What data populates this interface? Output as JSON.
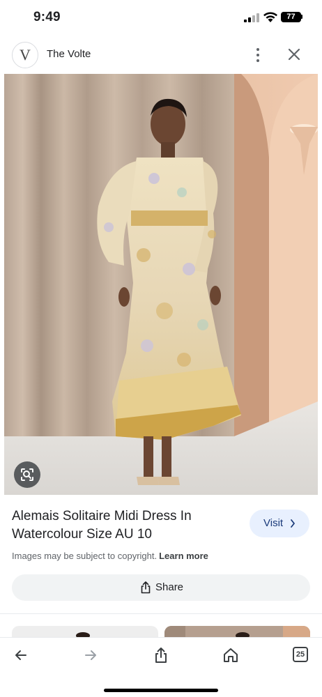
{
  "status_bar": {
    "time": "9:49",
    "battery": "77"
  },
  "header": {
    "logo_letter": "V",
    "site_name": "The Volte"
  },
  "result": {
    "title": "Alemais Solitaire Midi Dress In Watercolour Size AU 10",
    "visit_label": "Visit",
    "copyright_text": "Images may be subject to copyright.",
    "learn_more_label": "Learn more",
    "share_label": "Share"
  },
  "bottom_nav": {
    "tab_count": "25"
  },
  "icons": {
    "back": "arrow-left-icon",
    "forward": "arrow-right-icon",
    "share": "share-icon",
    "home": "home-icon",
    "more": "more-vert-icon",
    "close": "close-icon",
    "lens": "lens-icon"
  },
  "colors": {
    "visit_bg": "#e8f0fe",
    "visit_text": "#1a3a7a",
    "share_bg": "#f1f3f4"
  }
}
